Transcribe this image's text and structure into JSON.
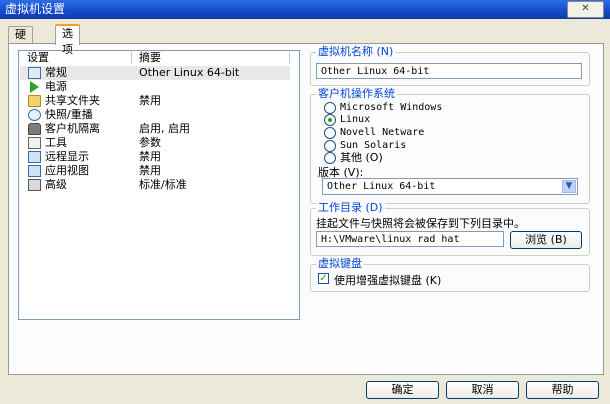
{
  "window": {
    "title": "虚拟机设置",
    "close_label": "✕"
  },
  "tabs": [
    {
      "label": "硬件"
    },
    {
      "label": "选项"
    }
  ],
  "settings_list": {
    "col_setting": "设置",
    "col_summary": "摘要",
    "rows": [
      {
        "name": "常规",
        "summary": "Other Linux 64-bit",
        "icon": "general-icon"
      },
      {
        "name": "电源",
        "summary": "",
        "icon": "power-icon"
      },
      {
        "name": "共享文件夹",
        "summary": "禁用",
        "icon": "shared-folder-icon"
      },
      {
        "name": "快照/重播",
        "summary": "",
        "icon": "snapshot-icon"
      },
      {
        "name": "客户机隔离",
        "summary": "启用, 启用",
        "icon": "isolation-lock-icon"
      },
      {
        "name": "工具",
        "summary": "参数",
        "icon": "tools-icon"
      },
      {
        "name": "远程显示",
        "summary": "禁用",
        "icon": "remote-display-icon"
      },
      {
        "name": "应用视图",
        "summary": "禁用",
        "icon": "app-view-icon"
      },
      {
        "name": "高级",
        "summary": "标准/标准",
        "icon": "advanced-icon"
      }
    ]
  },
  "vm_name": {
    "label": "虚拟机名称 (N)",
    "value": "Other Linux 64-bit"
  },
  "guest_os": {
    "label": "客户机操作系统",
    "options": [
      "Microsoft Windows",
      "Linux",
      "Novell Netware",
      "Sun Solaris",
      "其他 (O)"
    ],
    "selected_index": 1,
    "version_label": "版本 (V):",
    "version_value": "Other Linux 64-bit"
  },
  "work_dir": {
    "label": "工作目录 (D)",
    "description": "挂起文件与快照将会被保存到下列目录中。",
    "path": "H:\\VMware\\linux rad hat",
    "browse_label": "浏览 (B)"
  },
  "virtual_keyboard": {
    "label": "虚拟键盘",
    "checkbox_label": "使用增强虚拟键盘 (K)",
    "checked": true
  },
  "footer": {
    "ok_label": "确定",
    "cancel_label": "取消",
    "help_label": "帮助"
  }
}
